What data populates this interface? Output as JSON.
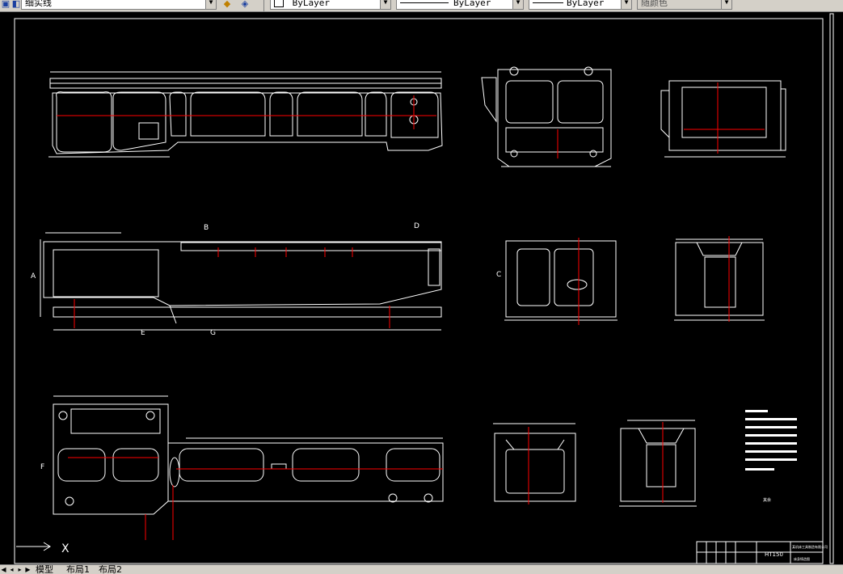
{
  "toolbar": {
    "linetype_combo": "细实线",
    "layer_color": "ByLayer",
    "linetype": "ByLayer",
    "lineweight": "ByLayer",
    "plot_style": "随颜色"
  },
  "drawing": {
    "section_labels": [
      "A",
      "B",
      "C",
      "D",
      "E",
      "F",
      "G"
    ],
    "title_block": {
      "material": "HT150",
      "company": "某机床工具制造有限公司",
      "drawing_name": "床身铸造图"
    },
    "roughness_note": "其余"
  },
  "ucs": {
    "x_label": "X"
  },
  "tabs": {
    "model": "模型",
    "layout1": "布局1",
    "layout2": "布局2"
  },
  "colors": {
    "background": "#000000",
    "line_white": "#ffffff",
    "centerline_red": "#ff0000",
    "toolbar_gray": "#d4d0c8"
  }
}
